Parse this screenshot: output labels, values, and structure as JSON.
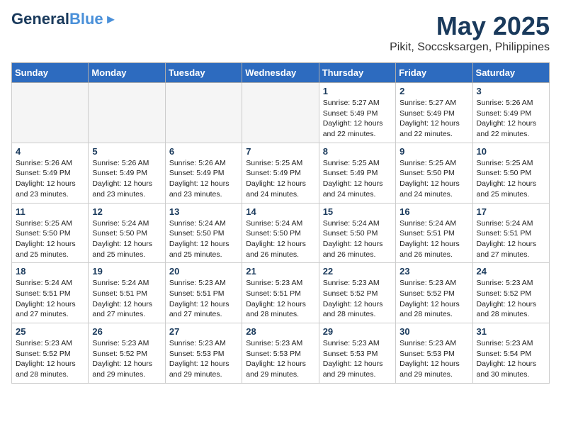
{
  "logo": {
    "line1": "General",
    "line2": "Blue"
  },
  "title": "May 2025",
  "subtitle": "Pikit, Soccsksargen, Philippines",
  "days_of_week": [
    "Sunday",
    "Monday",
    "Tuesday",
    "Wednesday",
    "Thursday",
    "Friday",
    "Saturday"
  ],
  "weeks": [
    [
      {
        "day": "",
        "info": ""
      },
      {
        "day": "",
        "info": ""
      },
      {
        "day": "",
        "info": ""
      },
      {
        "day": "",
        "info": ""
      },
      {
        "day": "1",
        "info": "Sunrise: 5:27 AM\nSunset: 5:49 PM\nDaylight: 12 hours\nand 22 minutes."
      },
      {
        "day": "2",
        "info": "Sunrise: 5:27 AM\nSunset: 5:49 PM\nDaylight: 12 hours\nand 22 minutes."
      },
      {
        "day": "3",
        "info": "Sunrise: 5:26 AM\nSunset: 5:49 PM\nDaylight: 12 hours\nand 22 minutes."
      }
    ],
    [
      {
        "day": "4",
        "info": "Sunrise: 5:26 AM\nSunset: 5:49 PM\nDaylight: 12 hours\nand 23 minutes."
      },
      {
        "day": "5",
        "info": "Sunrise: 5:26 AM\nSunset: 5:49 PM\nDaylight: 12 hours\nand 23 minutes."
      },
      {
        "day": "6",
        "info": "Sunrise: 5:26 AM\nSunset: 5:49 PM\nDaylight: 12 hours\nand 23 minutes."
      },
      {
        "day": "7",
        "info": "Sunrise: 5:25 AM\nSunset: 5:49 PM\nDaylight: 12 hours\nand 24 minutes."
      },
      {
        "day": "8",
        "info": "Sunrise: 5:25 AM\nSunset: 5:49 PM\nDaylight: 12 hours\nand 24 minutes."
      },
      {
        "day": "9",
        "info": "Sunrise: 5:25 AM\nSunset: 5:50 PM\nDaylight: 12 hours\nand 24 minutes."
      },
      {
        "day": "10",
        "info": "Sunrise: 5:25 AM\nSunset: 5:50 PM\nDaylight: 12 hours\nand 25 minutes."
      }
    ],
    [
      {
        "day": "11",
        "info": "Sunrise: 5:25 AM\nSunset: 5:50 PM\nDaylight: 12 hours\nand 25 minutes."
      },
      {
        "day": "12",
        "info": "Sunrise: 5:24 AM\nSunset: 5:50 PM\nDaylight: 12 hours\nand 25 minutes."
      },
      {
        "day": "13",
        "info": "Sunrise: 5:24 AM\nSunset: 5:50 PM\nDaylight: 12 hours\nand 25 minutes."
      },
      {
        "day": "14",
        "info": "Sunrise: 5:24 AM\nSunset: 5:50 PM\nDaylight: 12 hours\nand 26 minutes."
      },
      {
        "day": "15",
        "info": "Sunrise: 5:24 AM\nSunset: 5:50 PM\nDaylight: 12 hours\nand 26 minutes."
      },
      {
        "day": "16",
        "info": "Sunrise: 5:24 AM\nSunset: 5:51 PM\nDaylight: 12 hours\nand 26 minutes."
      },
      {
        "day": "17",
        "info": "Sunrise: 5:24 AM\nSunset: 5:51 PM\nDaylight: 12 hours\nand 27 minutes."
      }
    ],
    [
      {
        "day": "18",
        "info": "Sunrise: 5:24 AM\nSunset: 5:51 PM\nDaylight: 12 hours\nand 27 minutes."
      },
      {
        "day": "19",
        "info": "Sunrise: 5:24 AM\nSunset: 5:51 PM\nDaylight: 12 hours\nand 27 minutes."
      },
      {
        "day": "20",
        "info": "Sunrise: 5:23 AM\nSunset: 5:51 PM\nDaylight: 12 hours\nand 27 minutes."
      },
      {
        "day": "21",
        "info": "Sunrise: 5:23 AM\nSunset: 5:51 PM\nDaylight: 12 hours\nand 28 minutes."
      },
      {
        "day": "22",
        "info": "Sunrise: 5:23 AM\nSunset: 5:52 PM\nDaylight: 12 hours\nand 28 minutes."
      },
      {
        "day": "23",
        "info": "Sunrise: 5:23 AM\nSunset: 5:52 PM\nDaylight: 12 hours\nand 28 minutes."
      },
      {
        "day": "24",
        "info": "Sunrise: 5:23 AM\nSunset: 5:52 PM\nDaylight: 12 hours\nand 28 minutes."
      }
    ],
    [
      {
        "day": "25",
        "info": "Sunrise: 5:23 AM\nSunset: 5:52 PM\nDaylight: 12 hours\nand 28 minutes."
      },
      {
        "day": "26",
        "info": "Sunrise: 5:23 AM\nSunset: 5:52 PM\nDaylight: 12 hours\nand 29 minutes."
      },
      {
        "day": "27",
        "info": "Sunrise: 5:23 AM\nSunset: 5:53 PM\nDaylight: 12 hours\nand 29 minutes."
      },
      {
        "day": "28",
        "info": "Sunrise: 5:23 AM\nSunset: 5:53 PM\nDaylight: 12 hours\nand 29 minutes."
      },
      {
        "day": "29",
        "info": "Sunrise: 5:23 AM\nSunset: 5:53 PM\nDaylight: 12 hours\nand 29 minutes."
      },
      {
        "day": "30",
        "info": "Sunrise: 5:23 AM\nSunset: 5:53 PM\nDaylight: 12 hours\nand 29 minutes."
      },
      {
        "day": "31",
        "info": "Sunrise: 5:23 AM\nSunset: 5:54 PM\nDaylight: 12 hours\nand 30 minutes."
      }
    ]
  ]
}
